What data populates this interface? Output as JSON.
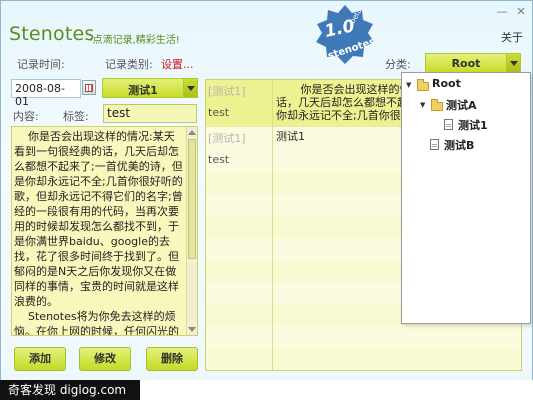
{
  "header": {
    "app_title": "Stenotes",
    "slogan": "-点滴记录,精彩生活!",
    "about_label": "关于",
    "close_symbol": "✕",
    "minimize_symbol": "—"
  },
  "badge": {
    "version": "1.0",
    "beta": "beta",
    "name": "stenotes",
    "color": "#3f79b8"
  },
  "form": {
    "record_time_label": "记录时间:",
    "record_category_label": "记录类别:",
    "settings_link": "设置...",
    "date_value": "2008-08-01",
    "category_value": "测试1",
    "content_label": "内容:",
    "tag_label": "标签:",
    "tag_value": "test",
    "category_filter_label": "分类:",
    "category_filter_value": "Root",
    "content_text": "    你是否会出现这样的情况:某天看到一句很经典的话，几天后却怎么都想不起来了;一首优美的诗，但是你却永远记不全;几首你很好听的歌，但却永远记不得它们的名字;曾经的一段很有用的代码，当再次要用的时候却发现怎么都找不到，于是你满世界baidu、google的去找，花了很多时间终于找到了。但郁闷的是N天之后你发现你又在做同样的事情，宝贵的时间就是这样浪费的。\n    Stenotes将为你免去这样的烦恼。在你上网的时候，任何闪光的思维片段:一段文字，一首歌，一条网址，一个名字，一个电话号码，你都"
  },
  "buttons": {
    "add": "添加",
    "edit": "修改",
    "delete": "删除"
  },
  "list": {
    "rows": [
      {
        "date": "[测试1]",
        "tag": "test",
        "text": "       你是否会出现这样的情况\n话，几天后却怎么都想不起来\n你却永远记不全;几首你很好"
      },
      {
        "date": "[测试1]",
        "tag": "test",
        "text": "测试1"
      }
    ]
  },
  "tree": {
    "nodes": [
      {
        "label": "Root",
        "icon": "folder-icon",
        "expanded": true
      },
      {
        "label": "测试A",
        "icon": "folder-icon",
        "expanded": true
      },
      {
        "label": "测试1",
        "icon": "doc-icon"
      },
      {
        "label": "测试B",
        "icon": "doc-icon"
      }
    ]
  },
  "watermark": "奇客发现 diglog.com",
  "colors": {
    "accent_green": "#5a8c1e",
    "button_lime": "#c7de28",
    "field_yellow": "#f8f8bd",
    "link_red": "#d4141e"
  }
}
